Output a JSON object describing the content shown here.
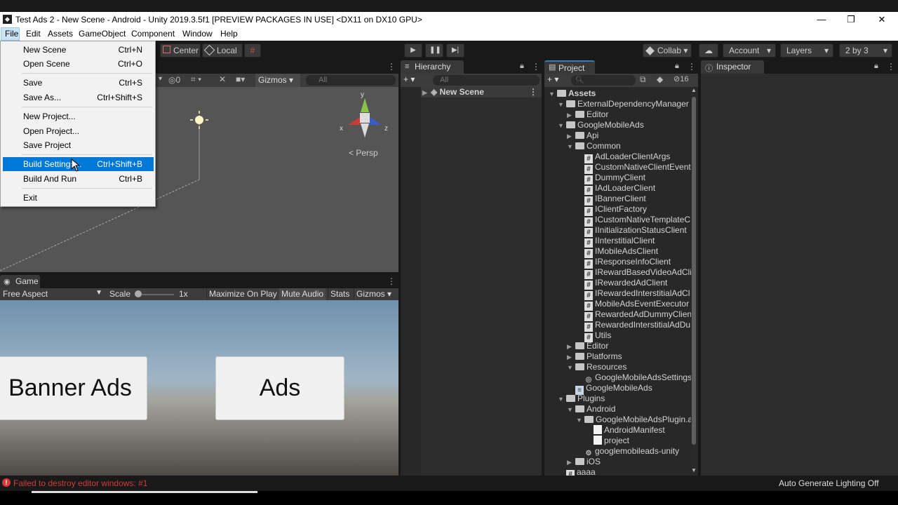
{
  "window": {
    "title": "Test Ads 2 - New Scene - Android - Unity 2019.3.5f1 [PREVIEW PACKAGES IN USE] <DX11 on DX10 GPU>"
  },
  "menu": [
    "File",
    "Edit",
    "Assets",
    "GameObject",
    "Component",
    "Window",
    "Help"
  ],
  "file_menu": {
    "new_scene": "New Scene",
    "new_scene_sc": "Ctrl+N",
    "open_scene": "Open Scene",
    "open_scene_sc": "Ctrl+O",
    "save": "Save",
    "save_sc": "Ctrl+S",
    "save_as": "Save As...",
    "save_as_sc": "Ctrl+Shift+S",
    "new_project": "New Project...",
    "open_project": "Open Project...",
    "save_project": "Save Project",
    "build_settings": "Build Settings...",
    "build_settings_sc": "Ctrl+Shift+B",
    "build_run": "Build And Run",
    "build_run_sc": "Ctrl+B",
    "exit": "Exit"
  },
  "toolbar": {
    "center": "Center",
    "local": "Local",
    "collab": "Collab",
    "account": "Account",
    "layers": "Layers",
    "layout": "2 by 3"
  },
  "scene": {
    "hidden_count": "0",
    "gizmos": "Gizmos",
    "search": "All",
    "persp": "< Persp",
    "axis_x": "x",
    "axis_y": "y",
    "axis_z": "z"
  },
  "game": {
    "tab": "Game",
    "aspect": "Free Aspect",
    "scale_label": "Scale",
    "scale_value": "1x",
    "maximize": "Maximize On Play",
    "mute": "Mute Audio",
    "stats": "Stats",
    "gizmos": "Gizmos",
    "btn_banner": "Banner Ads",
    "btn_ads": "Ads"
  },
  "hierarchy": {
    "tab": "Hierarchy",
    "search": "All",
    "scene": "New Scene"
  },
  "project": {
    "tab": "Project",
    "hidden_count": "16",
    "tree": [
      {
        "label": "Assets",
        "d": 0,
        "t": "f",
        "o": true,
        "b": true
      },
      {
        "label": "ExternalDependencyManager",
        "d": 1,
        "t": "f",
        "o": true
      },
      {
        "label": "Editor",
        "d": 2,
        "t": "f",
        "o": false
      },
      {
        "label": "GoogleMobileAds",
        "d": 1,
        "t": "f",
        "o": true
      },
      {
        "label": "Api",
        "d": 2,
        "t": "f",
        "o": false
      },
      {
        "label": "Common",
        "d": 2,
        "t": "f",
        "o": true
      },
      {
        "label": "AdLoaderClientArgs",
        "d": 3,
        "t": "c"
      },
      {
        "label": "CustomNativeClientEvent",
        "d": 3,
        "t": "c"
      },
      {
        "label": "DummyClient",
        "d": 3,
        "t": "c"
      },
      {
        "label": "IAdLoaderClient",
        "d": 3,
        "t": "c"
      },
      {
        "label": "IBannerClient",
        "d": 3,
        "t": "c"
      },
      {
        "label": "IClientFactory",
        "d": 3,
        "t": "c"
      },
      {
        "label": "ICustomNativeTemplateC",
        "d": 3,
        "t": "c"
      },
      {
        "label": "IInitializationStatusClient",
        "d": 3,
        "t": "c"
      },
      {
        "label": "IInterstitialClient",
        "d": 3,
        "t": "c"
      },
      {
        "label": "IMobileAdsClient",
        "d": 3,
        "t": "c"
      },
      {
        "label": "IResponseInfoClient",
        "d": 3,
        "t": "c"
      },
      {
        "label": "IRewardBasedVideoAdCli",
        "d": 3,
        "t": "c"
      },
      {
        "label": "IRewardedAdClient",
        "d": 3,
        "t": "c"
      },
      {
        "label": "IRewardedInterstitialAdCl",
        "d": 3,
        "t": "c"
      },
      {
        "label": "MobileAdsEventExecutor",
        "d": 3,
        "t": "c"
      },
      {
        "label": "RewardedAdDummyClien",
        "d": 3,
        "t": "c"
      },
      {
        "label": "RewardedInterstitialAdDu",
        "d": 3,
        "t": "c"
      },
      {
        "label": "Utils",
        "d": 3,
        "t": "c"
      },
      {
        "label": "Editor",
        "d": 2,
        "t": "f",
        "o": false
      },
      {
        "label": "Platforms",
        "d": 2,
        "t": "f",
        "o": false
      },
      {
        "label": "Resources",
        "d": 2,
        "t": "f",
        "o": true
      },
      {
        "label": "GoogleMobileAdsSettings",
        "d": 3,
        "t": "s"
      },
      {
        "label": "GoogleMobileAds",
        "d": 2,
        "t": "a"
      },
      {
        "label": "Plugins",
        "d": 1,
        "t": "f",
        "o": true
      },
      {
        "label": "Android",
        "d": 2,
        "t": "f",
        "o": true
      },
      {
        "label": "GoogleMobileAdsPlugin.a",
        "d": 3,
        "t": "f",
        "o": true
      },
      {
        "label": "AndroidManifest",
        "d": 4,
        "t": "d"
      },
      {
        "label": "project",
        "d": 4,
        "t": "d"
      },
      {
        "label": "googlemobileads-unity",
        "d": 3,
        "t": "p"
      },
      {
        "label": "iOS",
        "d": 2,
        "t": "f",
        "o": false
      },
      {
        "label": "aaaa",
        "d": 1,
        "t": "c"
      }
    ]
  },
  "inspector": {
    "tab": "Inspector"
  },
  "status": {
    "error": "Failed to destroy editor windows: #1",
    "lighting": "Auto Generate Lighting Off"
  },
  "colors": {
    "error": "#d13b3b",
    "highlight": "#0078d7",
    "project_tab_accent": "#3a79bb"
  }
}
